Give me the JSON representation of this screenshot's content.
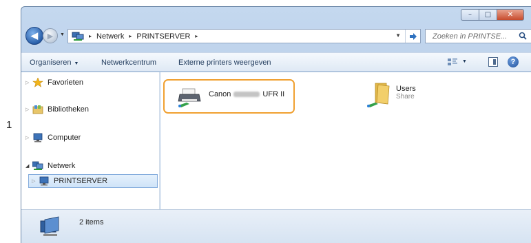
{
  "step_number": "1",
  "window": {
    "controls": {
      "minimize": "–",
      "maximize": "□",
      "close": "✕"
    }
  },
  "navigation": {
    "back": "◀",
    "forward": "▶",
    "address": {
      "segments": [
        "Netwerk",
        "PRINTSERVER"
      ],
      "separator": "▸"
    },
    "search_placeholder": "Zoeken in PRINTSE..."
  },
  "toolbar": {
    "organize": "Organiseren",
    "network_center": "Netwerkcentrum",
    "show_printers": "Externe printers weergeven"
  },
  "sidebar": {
    "favorites": "Favorieten",
    "libraries": "Bibliotheken",
    "computer": "Computer",
    "network": "Netwerk",
    "printserver": "PRINTSERVER"
  },
  "content": {
    "printer": {
      "name_prefix": "Canon",
      "name_suffix": "UFR II"
    },
    "users": {
      "name": "Users",
      "type": "Share"
    }
  },
  "status": {
    "count": "2 items"
  },
  "colors": {
    "highlight": "#f0a030",
    "selection": "#cfe3f8"
  }
}
